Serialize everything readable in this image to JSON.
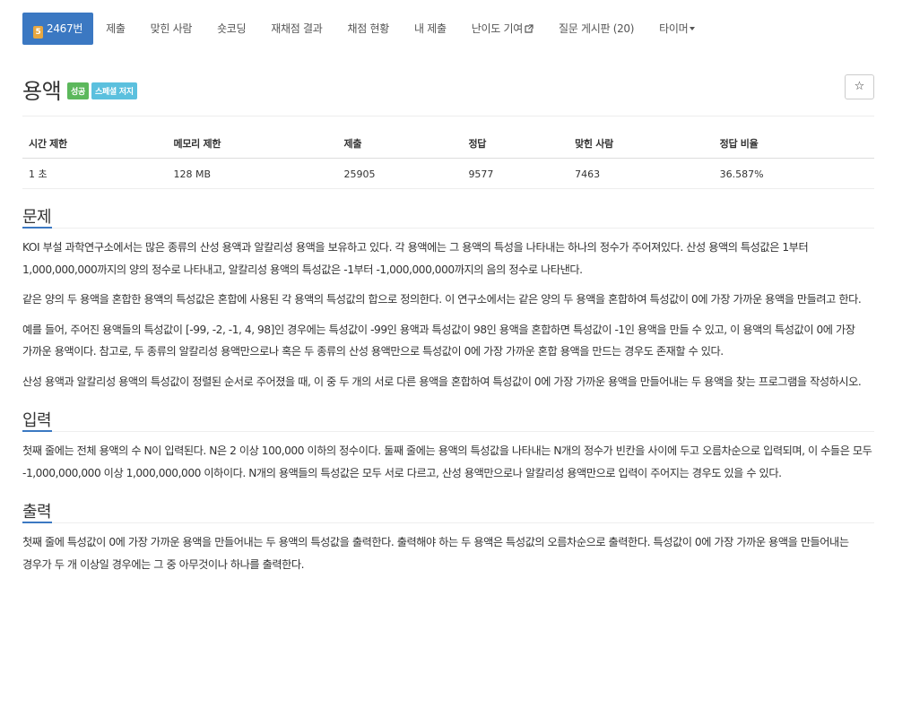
{
  "nav": {
    "tier_badge": "5",
    "problem_number": "2467번",
    "items": [
      "제출",
      "맞힌 사람",
      "숏코딩",
      "재채점 결과",
      "채점 현황",
      "내 제출",
      "난이도 기여",
      "질문 게시판 (20)",
      "타이머"
    ]
  },
  "title": "용액",
  "labels": {
    "status": "성공",
    "special": "스페셜 저지"
  },
  "star_icon": "☆",
  "info_table": {
    "headers": [
      "시간 제한",
      "메모리 제한",
      "제출",
      "정답",
      "맞힌 사람",
      "정답 비율"
    ],
    "row": [
      "1 초",
      "128 MB",
      "25905",
      "9577",
      "7463",
      "36.587%"
    ]
  },
  "sections": {
    "problem": {
      "heading": "문제",
      "paragraphs": [
        "KOI 부설 과학연구소에서는 많은 종류의 산성 용액과 알칼리성 용액을 보유하고 있다. 각 용액에는 그 용액의 특성을 나타내는 하나의 정수가 주어져있다. 산성 용액의 특성값은 1부터 1,000,000,000까지의 양의 정수로 나타내고, 알칼리성 용액의 특성값은 -1부터 -1,000,000,000까지의 음의 정수로 나타낸다.",
        "같은 양의 두 용액을 혼합한 용액의 특성값은 혼합에 사용된 각 용액의 특성값의 합으로 정의한다. 이 연구소에서는 같은 양의 두 용액을 혼합하여 특성값이 0에 가장 가까운 용액을 만들려고 한다.",
        "예를 들어, 주어진 용액들의 특성값이 [-99, -2, -1, 4, 98]인 경우에는 특성값이 -99인 용액과 특성값이 98인 용액을 혼합하면 특성값이 -1인 용액을 만들 수 있고, 이 용액의 특성값이 0에 가장 가까운 용액이다. 참고로, 두 종류의 알칼리성 용액만으로나 혹은 두 종류의 산성 용액만으로 특성값이 0에 가장 가까운 혼합 용액을 만드는 경우도 존재할 수 있다.",
        "산성 용액과 알칼리성 용액의 특성값이 정렬된 순서로 주어졌을 때, 이 중 두 개의 서로 다른 용액을 혼합하여 특성값이 0에 가장 가까운 용액을 만들어내는 두 용액을 찾는 프로그램을 작성하시오."
      ]
    },
    "input": {
      "heading": "입력",
      "paragraphs": [
        "첫째 줄에는 전체 용액의 수 N이 입력된다. N은 2 이상 100,000 이하의 정수이다. 둘째 줄에는 용액의 특성값을 나타내는 N개의 정수가 빈칸을 사이에 두고 오름차순으로 입력되며, 이 수들은 모두 -1,000,000,000 이상 1,000,000,000 이하이다. N개의 용액들의 특성값은 모두 서로 다르고, 산성 용액만으로나 알칼리성 용액만으로 입력이 주어지는 경우도 있을 수 있다."
      ]
    },
    "output": {
      "heading": "출력",
      "paragraphs": [
        "첫째 줄에 특성값이 0에 가장 가까운 용액을 만들어내는 두 용액의 특성값을 출력한다. 출력해야 하는 두 용액은 특성값의 오름차순으로 출력한다. 특성값이 0에 가장 가까운 용액을 만들어내는 경우가 두 개 이상일 경우에는 그 중 아무것이나 하나를 출력한다."
      ]
    }
  }
}
